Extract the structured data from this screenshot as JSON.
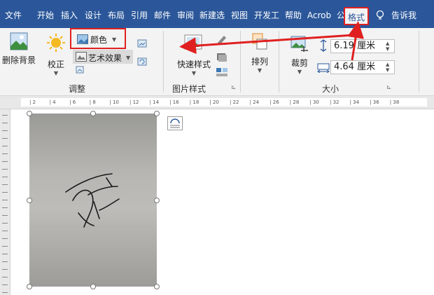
{
  "tabs": [
    {
      "label": "文件"
    },
    {
      "label": "开始"
    },
    {
      "label": "插入"
    },
    {
      "label": "设计"
    },
    {
      "label": "布局"
    },
    {
      "label": "引用"
    },
    {
      "label": "邮件"
    },
    {
      "label": "审阅"
    },
    {
      "label": "新建选"
    },
    {
      "label": "视图"
    },
    {
      "label": "开发工"
    },
    {
      "label": "帮助"
    },
    {
      "label": "Acrob"
    },
    {
      "label": "公文"
    },
    {
      "label": "格式"
    }
  ],
  "tell_me": {
    "label": "告诉我",
    "icon": "lightbulb-icon"
  },
  "ribbon": {
    "adjust": {
      "remove_bg": "删除背景",
      "correct": "校正",
      "color": "颜色",
      "artistic": "艺术效果",
      "group_label": "调整"
    },
    "styles": {
      "quick_styles": "快速样式",
      "group_label": "图片样式"
    },
    "arrange": {
      "label": "排列"
    },
    "size": {
      "crop": "裁剪",
      "height_value": "6.19",
      "height_unit": "厘米",
      "width_value": "4.64",
      "width_unit": "厘米",
      "group_label": "大小"
    }
  },
  "ruler": {
    "marks": [
      "2",
      "4",
      "6",
      "8",
      "10",
      "12",
      "14",
      "16",
      "18",
      "20",
      "22",
      "24",
      "26",
      "28",
      "30",
      "32",
      "34",
      "36",
      "38"
    ]
  },
  "colors": {
    "tabbar": "#2b579a",
    "ribbon": "#f3f3f3",
    "highlight": "#e02020"
  }
}
